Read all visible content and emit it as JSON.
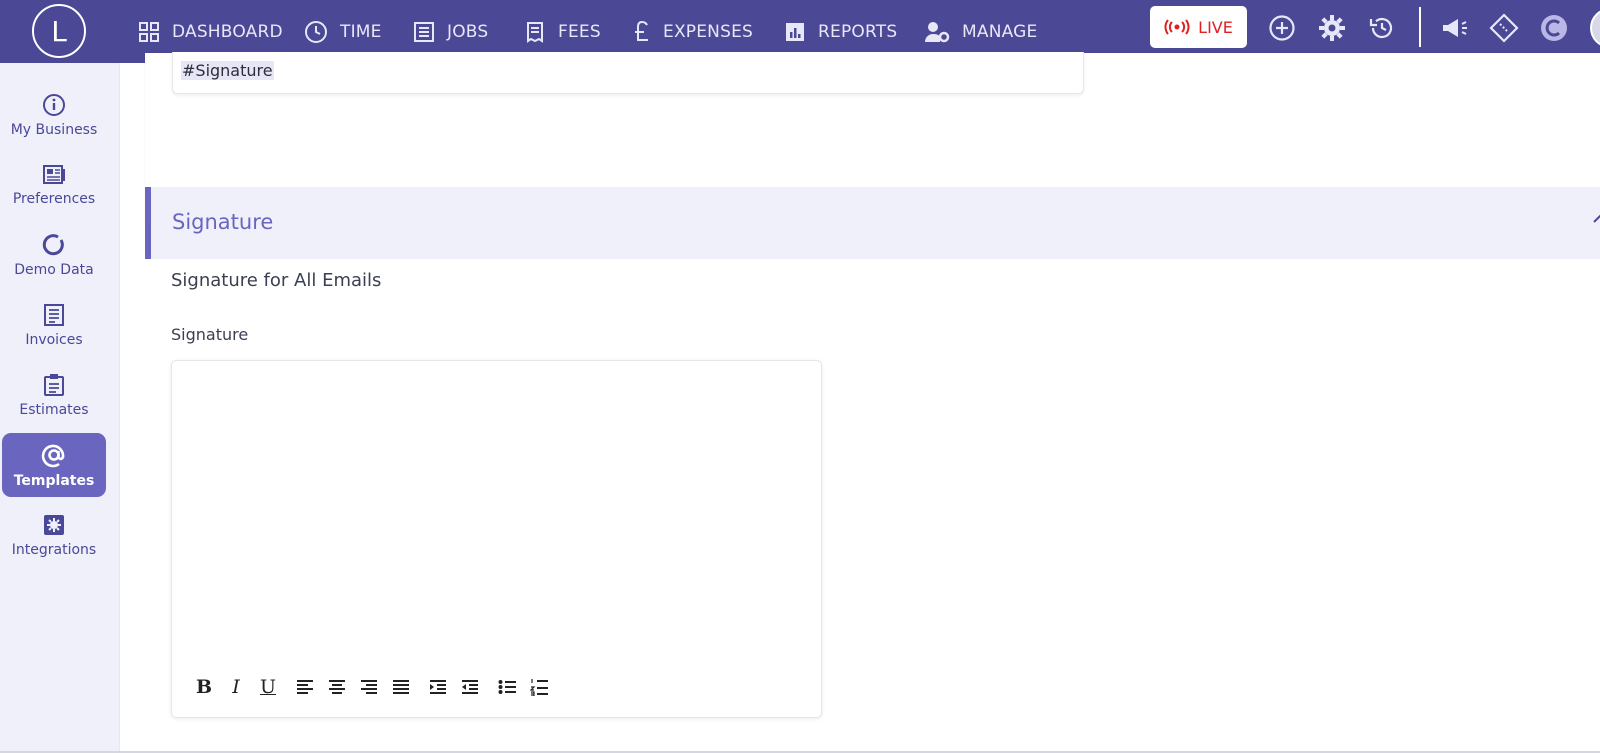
{
  "app": {
    "logo_letter": "L"
  },
  "topnav": {
    "items": [
      {
        "label": "DASHBOARD",
        "icon": "dashboard-icon"
      },
      {
        "label": "TIME",
        "icon": "clock-icon"
      },
      {
        "label": "JOBS",
        "icon": "list-icon"
      },
      {
        "label": "FEES",
        "icon": "receipt-icon"
      },
      {
        "label": "EXPENSES",
        "icon": "pound-icon"
      },
      {
        "label": "REPORTS",
        "icon": "bar-chart-icon"
      },
      {
        "label": "MANAGE",
        "icon": "user-gear-icon"
      }
    ],
    "live_label": "LIVE"
  },
  "sidebar": {
    "items": [
      {
        "label": "My Business",
        "icon": "info-icon"
      },
      {
        "label": "Preferences",
        "icon": "preferences-icon"
      },
      {
        "label": "Demo Data",
        "icon": "refresh-icon"
      },
      {
        "label": "Invoices",
        "icon": "invoice-icon"
      },
      {
        "label": "Estimates",
        "icon": "clipboard-icon"
      },
      {
        "label": "Templates",
        "icon": "at-icon",
        "active": true
      },
      {
        "label": "Integrations",
        "icon": "integrations-icon"
      }
    ]
  },
  "main": {
    "previous_field_value": "#Signature",
    "section_title": "Signature",
    "subtitle": "Signature for All Emails",
    "field_label": "Signature",
    "editor_value": "",
    "toolbar": {
      "bold": "B",
      "italic": "I",
      "underline": "U"
    }
  },
  "colors": {
    "topbar": "#4b4895",
    "accent": "#6a65bf",
    "sidebar_bg": "#f0f0fa",
    "live_red": "#e02020"
  }
}
